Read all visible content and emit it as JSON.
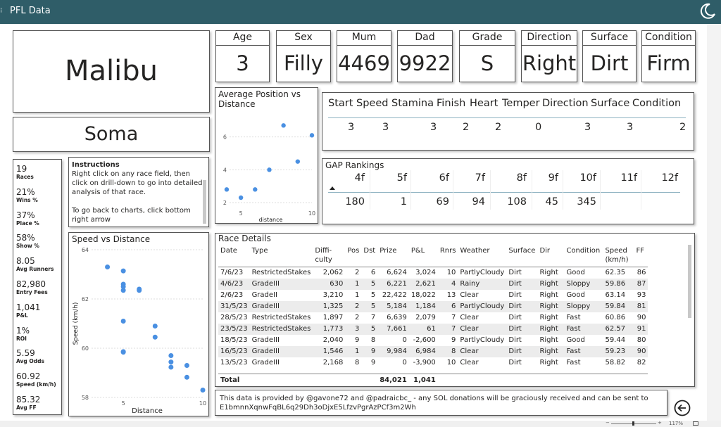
{
  "app": {
    "title": "PFL Data"
  },
  "horse": {
    "name": "Malibu",
    "sire": "Soma"
  },
  "cards": [
    {
      "label": "Age",
      "value": "3"
    },
    {
      "label": "Sex",
      "value": "Filly"
    },
    {
      "label": "Mum",
      "value": "4469"
    },
    {
      "label": "Dad",
      "value": "9922"
    },
    {
      "label": "Grade",
      "value": "S"
    },
    {
      "label": "Direction",
      "value": "Right"
    },
    {
      "label": "Surface",
      "value": "Dirt"
    },
    {
      "label": "Condition",
      "value": "Firm"
    }
  ],
  "kpis": [
    {
      "value": "19",
      "label": "Races"
    },
    {
      "value": "21%",
      "label": "Wins %"
    },
    {
      "value": "37%",
      "label": "Place %"
    },
    {
      "value": "58%",
      "label": "Show %"
    },
    {
      "value": "8.05",
      "label": "Avg Runners"
    },
    {
      "value": "82,980",
      "label": "Entry Fees"
    },
    {
      "value": "1,041",
      "label": "P&L"
    },
    {
      "value": "1%",
      "label": "ROI"
    },
    {
      "value": "5.59",
      "label": "Avg Odds"
    },
    {
      "value": "60.92",
      "label": "Speed (km/h)"
    },
    {
      "value": "85.32",
      "label": "Avg FF"
    }
  ],
  "instructions": {
    "heading": "Instructions",
    "line1": "Right click on any race field, then click on drill-down to go into detailed analysis of that race.",
    "line2": "To go back to charts, click bottom right arrow"
  },
  "ratings": {
    "headers": [
      "Start",
      "Speed",
      "Stamina",
      "Finish",
      "Heart",
      "Temper",
      "Direction",
      "Surface",
      "Condition"
    ],
    "values": [
      "3",
      "3",
      "3",
      "2",
      "2",
      "0",
      "3",
      "3",
      "2"
    ]
  },
  "gap": {
    "title": "GAP Rankings",
    "headers": [
      "4f",
      "5f",
      "6f",
      "7f",
      "8f",
      "9f",
      "10f",
      "11f",
      "12f"
    ],
    "values": [
      "180",
      "1",
      "69",
      "94",
      "108",
      "45",
      "345",
      "",
      ""
    ]
  },
  "race_details": {
    "title": "Race Details",
    "columns": [
      "Date",
      "Type",
      "Diffi-\nculty",
      "Pos",
      "Dst",
      "Prize",
      "P&L",
      "Rnrs",
      "Weather",
      "Surface",
      "Dir",
      "Condition",
      "Speed\n(km/h)",
      "FF"
    ],
    "rows": [
      [
        "7/6/23",
        "RestrictedStakes",
        "2,062",
        "2",
        "6",
        "6,624",
        "3,024",
        "10",
        "PartlyCloudy",
        "Dirt",
        "Right",
        "Good",
        "62.35",
        "86"
      ],
      [
        "4/6/23",
        "GradeIII",
        "630",
        "1",
        "5",
        "6,221",
        "2,621",
        "4",
        "Rainy",
        "Dirt",
        "Right",
        "Sloppy",
        "59.86",
        "87"
      ],
      [
        "2/6/23",
        "GradeII",
        "3,210",
        "1",
        "5",
        "22,422",
        "18,022",
        "13",
        "Clear",
        "Dirt",
        "Right",
        "Good",
        "63.14",
        "93"
      ],
      [
        "31/5/23",
        "GradeIII",
        "1,325",
        "2",
        "5",
        "5,184",
        "1,184",
        "6",
        "PartlyCloudy",
        "Dirt",
        "Right",
        "Sloppy",
        "59.84",
        "81"
      ],
      [
        "28/5/23",
        "RestrictedStakes",
        "1,897",
        "2",
        "7",
        "6,639",
        "2,079",
        "7",
        "Clear",
        "Dirt",
        "Right",
        "Fast",
        "60.86",
        "90"
      ],
      [
        "23/5/23",
        "RestrictedStakes",
        "1,773",
        "3",
        "5",
        "7,661",
        "61",
        "7",
        "Clear",
        "Dirt",
        "Right",
        "Fast",
        "62.57",
        "91"
      ],
      [
        "18/5/23",
        "GradeIII",
        "2,040",
        "9",
        "8",
        "0",
        "-2,600",
        "9",
        "PartlyCloudy",
        "Dirt",
        "Right",
        "Good",
        "59.44",
        "80"
      ],
      [
        "16/5/23",
        "GradeIII",
        "1,546",
        "1",
        "9",
        "9,984",
        "6,984",
        "8",
        "Clear",
        "Dirt",
        "Right",
        "Fast",
        "59.23",
        "90"
      ],
      [
        "13/5/23",
        "GradeIII",
        "2,168",
        "8",
        "9",
        "0",
        "-3,900",
        "10",
        "Clear",
        "Dirt",
        "Right",
        "Fast",
        "58.82",
        "82"
      ]
    ],
    "total": {
      "label": "Total",
      "prize": "84,021",
      "pnl": "1,041"
    }
  },
  "footer": {
    "text": "This data is provided by @gavone72 and @padraicbc_ - any SOL donations will be graciously received and can be sent to E1bmnnXqnwFqBL6q29Dh3oDjxE5LfzvPgrAzPCf3m2Wh"
  },
  "status": {
    "zoom": "117%"
  },
  "chart_data": [
    {
      "type": "scatter",
      "title": "Average Position vs Distance",
      "xlabel": "distance",
      "ylabel": "",
      "xlim": [
        4.2,
        10
      ],
      "ylim": [
        1.7,
        7.4
      ],
      "xticks": [
        "5",
        "10"
      ],
      "yticks": [
        "2",
        "4",
        "6"
      ],
      "points": [
        [
          4,
          2.8
        ],
        [
          5,
          2.3
        ],
        [
          6,
          2.8
        ],
        [
          7,
          4.0
        ],
        [
          8,
          6.7
        ],
        [
          9,
          4.5
        ],
        [
          10,
          6.1
        ]
      ]
    },
    {
      "type": "scatter",
      "title": "Speed vs Distance",
      "xlabel": "Distance",
      "ylabel": "Speed (km/h)",
      "xlim": [
        3,
        10
      ],
      "ylim": [
        58,
        64
      ],
      "xticks": [
        "5",
        "10"
      ],
      "yticks": [
        "58",
        "60",
        "62",
        "64"
      ],
      "points": [
        [
          4,
          63.3
        ],
        [
          5,
          63.14
        ],
        [
          5,
          62.6
        ],
        [
          5,
          62.5
        ],
        [
          5,
          62.35
        ],
        [
          5,
          61.1
        ],
        [
          5,
          59.86
        ],
        [
          5,
          59.84
        ],
        [
          6,
          62.4
        ],
        [
          6,
          62.35
        ],
        [
          7,
          60.9
        ],
        [
          7,
          60.45
        ],
        [
          8,
          59.7
        ],
        [
          8,
          59.44
        ],
        [
          8,
          59.23
        ],
        [
          9,
          59.3
        ],
        [
          9,
          58.82
        ],
        [
          10,
          58.3
        ]
      ]
    }
  ]
}
